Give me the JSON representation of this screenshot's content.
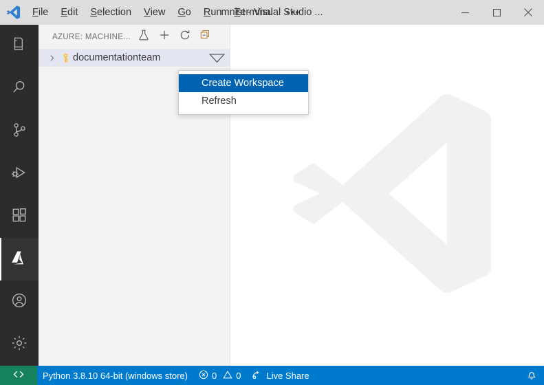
{
  "titlebar": {
    "logo_icon": "vscode-logo-icon",
    "menus": [
      {
        "label": "File",
        "mnemonic": "F"
      },
      {
        "label": "Edit",
        "mnemonic": "E"
      },
      {
        "label": "Selection",
        "mnemonic": "S"
      },
      {
        "label": "View",
        "mnemonic": "V"
      },
      {
        "label": "Go",
        "mnemonic": "G"
      },
      {
        "label": "Run",
        "mnemonic": "R"
      },
      {
        "label": "Terminal",
        "mnemonic": "T"
      }
    ],
    "overflow_label": "•••",
    "window_title": "mnist - Visual Studio ...",
    "controls": [
      {
        "name": "minimize-button",
        "icon": "minimize-icon"
      },
      {
        "name": "maximize-button",
        "icon": "maximize-icon"
      },
      {
        "name": "close-button",
        "icon": "close-icon"
      }
    ]
  },
  "activitybar": {
    "items": [
      {
        "name": "explorer",
        "icon": "files-icon",
        "active": false
      },
      {
        "name": "search",
        "icon": "search-icon",
        "active": false
      },
      {
        "name": "source-control",
        "icon": "branch-icon",
        "active": false
      },
      {
        "name": "run-debug",
        "icon": "run-debug-icon",
        "active": false
      },
      {
        "name": "extensions",
        "icon": "extensions-icon",
        "active": false
      },
      {
        "name": "azure",
        "icon": "azure-icon",
        "active": true
      }
    ],
    "bottom_items": [
      {
        "name": "accounts",
        "icon": "account-icon"
      },
      {
        "name": "manage",
        "icon": "gear-icon"
      }
    ]
  },
  "sidebar": {
    "title": "AZURE: MACHINE...",
    "actions": [
      {
        "name": "experiment-button",
        "icon": "flask-icon"
      },
      {
        "name": "add-button",
        "icon": "plus-icon"
      },
      {
        "name": "refresh-button",
        "icon": "refresh-icon"
      },
      {
        "name": "collapse-button",
        "icon": "collapse-all-icon"
      }
    ],
    "tree": [
      {
        "label": "documentationteam",
        "icon": "key-icon",
        "twisty": "chevron-right-icon",
        "filter_icon": "filter-icon",
        "selected": true
      }
    ]
  },
  "editor": {
    "watermark_icon": "vscode-watermark-logo"
  },
  "context_menu": {
    "items": [
      {
        "label": "Create Workspace",
        "selected": true
      },
      {
        "label": "Refresh",
        "selected": false
      }
    ]
  },
  "statusbar": {
    "remote_icon": "remote-indicator-icon",
    "python_label": "Python 3.8.10 64-bit (windows store)",
    "errors_icon": "error-icon",
    "errors_count": "0",
    "warnings_icon": "warning-icon",
    "warnings_count": "0",
    "liveshare_icon": "live-share-icon",
    "liveshare_label": "Live Share",
    "bell_icon": "bell-icon"
  },
  "colors": {
    "titlebar_bg": "#dddddd",
    "activitybar_bg": "#2c2c2c",
    "sidebar_bg": "#f3f3f3",
    "editor_bg": "#ffffff",
    "statusbar_bg": "#007acc",
    "remote_bg": "#16825d",
    "menu_highlight": "#0063b1",
    "tree_selected_bg": "#e4e6f1",
    "key_icon": "#f6c244"
  }
}
